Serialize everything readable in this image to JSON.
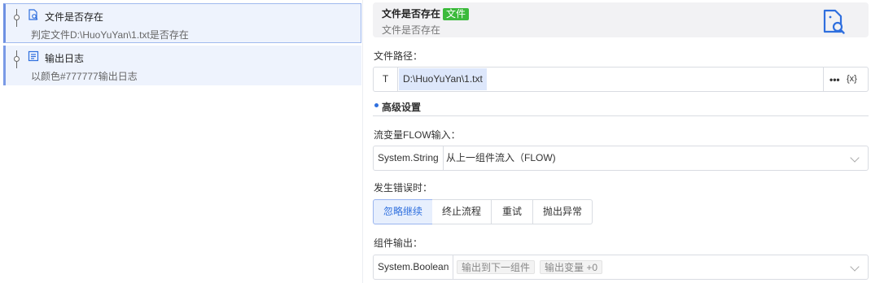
{
  "flow": {
    "nodes": [
      {
        "title": "文件是否存在",
        "desc": "判定文件D:\\HuoYuYan\\1.txt是否存在",
        "icon": "file-search-icon",
        "selected": true
      },
      {
        "title": "输出日志",
        "desc": "以颜色#777777输出日志",
        "icon": "log-output-icon",
        "selected": false
      }
    ]
  },
  "props": {
    "header": {
      "title": "文件是否存在",
      "tag": "文件",
      "subtitle": "文件是否存在",
      "icon": "file-search-icon"
    },
    "path_label": "文件路径：",
    "path": {
      "type_marker": "T",
      "value": "D:\\HuoYuYan\\1.txt",
      "more": "•••",
      "variable": "{x}"
    },
    "advanced": "高级设置",
    "flow_label": "流变量FLOW输入：",
    "flow_select": {
      "type": "System.String",
      "value": "从上一组件流入（FLOW)"
    },
    "error_label": "发生错误时：",
    "error_options": [
      "忽略继续",
      "终止流程",
      "重试",
      "抛出异常"
    ],
    "error_selected": "忽略继续",
    "output_label": "组件输出：",
    "output_select": {
      "type": "System.Boolean",
      "chips": [
        "输出到下一组件",
        "输出变量 +0"
      ]
    }
  },
  "colors": {
    "accent": "#2f6fde",
    "tag_green": "#3cba3c",
    "node_bg": "#eef3fd"
  }
}
